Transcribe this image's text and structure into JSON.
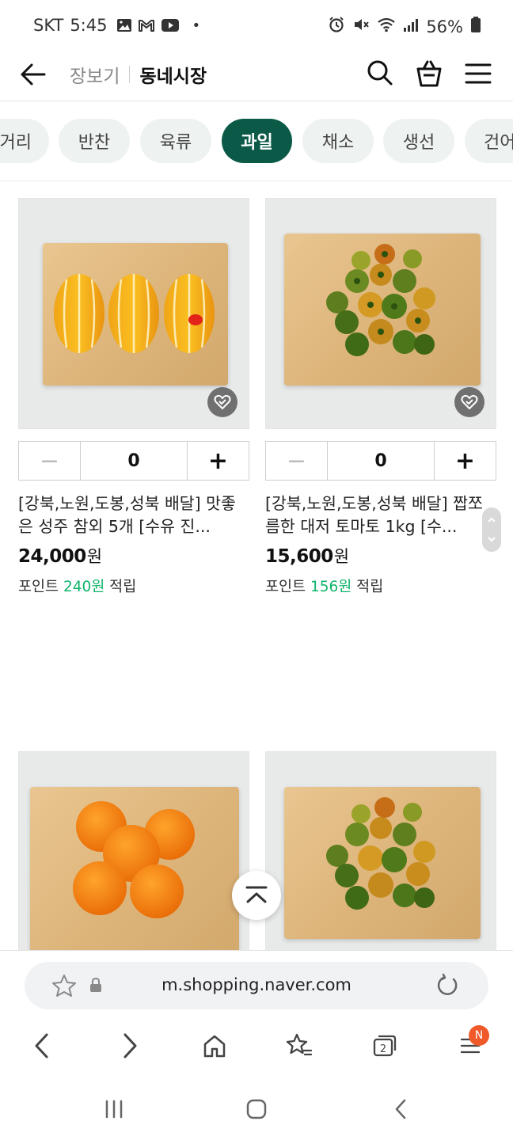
{
  "status": {
    "carrier": "SKT",
    "time": "5:45",
    "dot": "•",
    "battery": "56%",
    "icons_left": [
      "gallery-icon",
      "mail-icon",
      "youtube-icon"
    ],
    "icons_right": [
      "alarm-icon",
      "mute-icon",
      "wifi-icon",
      "signal-icon",
      "battery-icon"
    ]
  },
  "header": {
    "crumb_parent": "장보기",
    "crumb_current": "동네시장"
  },
  "categories": [
    {
      "label": "거리",
      "active": false
    },
    {
      "label": "반찬",
      "active": false
    },
    {
      "label": "육류",
      "active": false
    },
    {
      "label": "과일",
      "active": true
    },
    {
      "label": "채소",
      "active": false
    },
    {
      "label": "생선",
      "active": false
    },
    {
      "label": "건어",
      "active": false
    }
  ],
  "products": [
    {
      "title": "[강북,노원,도봉,성북 배달] 맛좋은 성주 참외 5개 [수유 진...",
      "qty": "0",
      "price": "24,000",
      "price_unit": "원",
      "points_prefix": "포인트 ",
      "points_value": "240원",
      "points_suffix": " 적립",
      "image": "melon"
    },
    {
      "title": "[강북,노원,도봉,성북 배달] 짭쪼름한 대저 토마토 1kg [수...",
      "qty": "0",
      "price": "15,600",
      "price_unit": "원",
      "points_prefix": "포인트 ",
      "points_value": "156원",
      "points_suffix": " 적립",
      "image": "tomato"
    },
    {
      "image": "tangerine"
    },
    {
      "image": "tomato"
    }
  ],
  "stepper": {
    "minus": "−",
    "plus": "+"
  },
  "browser": {
    "url": "m.shopping.naver.com",
    "tabs_count": "2",
    "menu_badge": "N"
  },
  "colors": {
    "active_chip": "#0b5a48",
    "points_accent": "#10b46a",
    "badge": "#f05a2a"
  }
}
